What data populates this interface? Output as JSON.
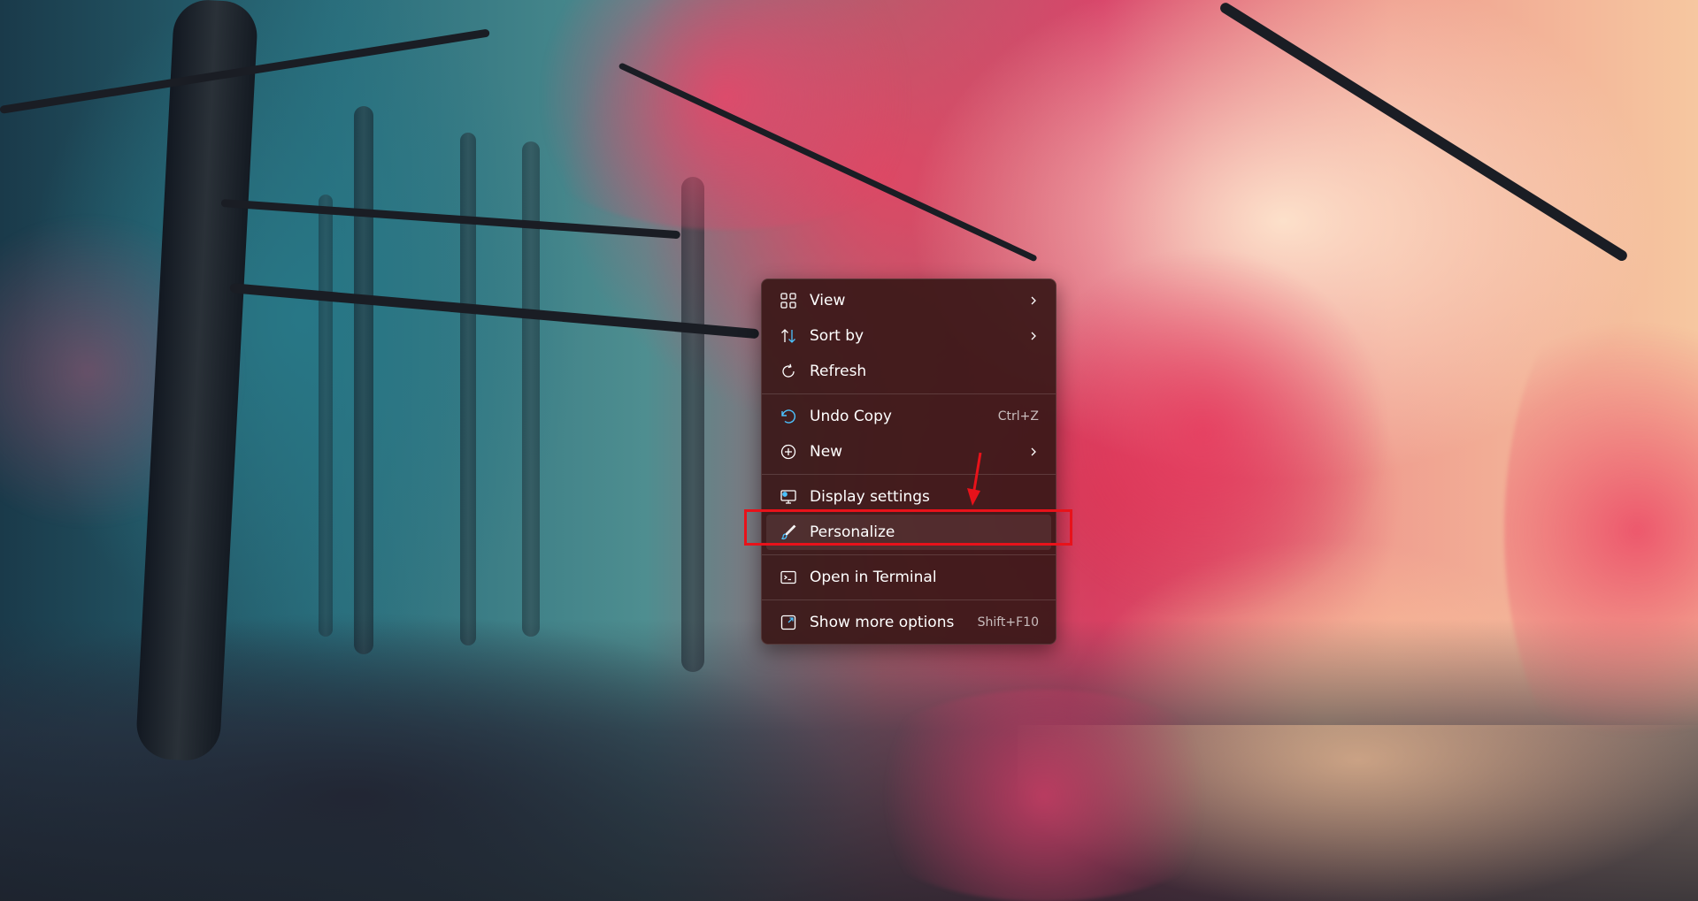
{
  "desktop": {
    "wallpaper": "autumn-forest-wallpaper"
  },
  "context_menu": {
    "items": [
      {
        "label": "View",
        "icon": "grid-icon",
        "has_submenu": true
      },
      {
        "label": "Sort by",
        "icon": "sort-icon",
        "has_submenu": true
      },
      {
        "label": "Refresh",
        "icon": "refresh-icon",
        "has_submenu": false
      },
      {
        "label": "Undo Copy",
        "icon": "undo-icon",
        "shortcut": "Ctrl+Z"
      },
      {
        "label": "New",
        "icon": "plus-circle-icon",
        "has_submenu": true
      },
      {
        "label": "Display settings",
        "icon": "display-icon"
      },
      {
        "label": "Personalize",
        "icon": "brush-icon",
        "highlighted": true
      },
      {
        "label": "Open in Terminal",
        "icon": "terminal-icon"
      },
      {
        "label": "Show more options",
        "icon": "expand-icon",
        "shortcut": "Shift+F10"
      }
    ]
  },
  "annotation": {
    "color": "#e8121a",
    "target": "Personalize"
  },
  "colors": {
    "menu_background": "#3a1818",
    "menu_text": "#ffffff",
    "accent_icon": "#4cc2ff"
  }
}
